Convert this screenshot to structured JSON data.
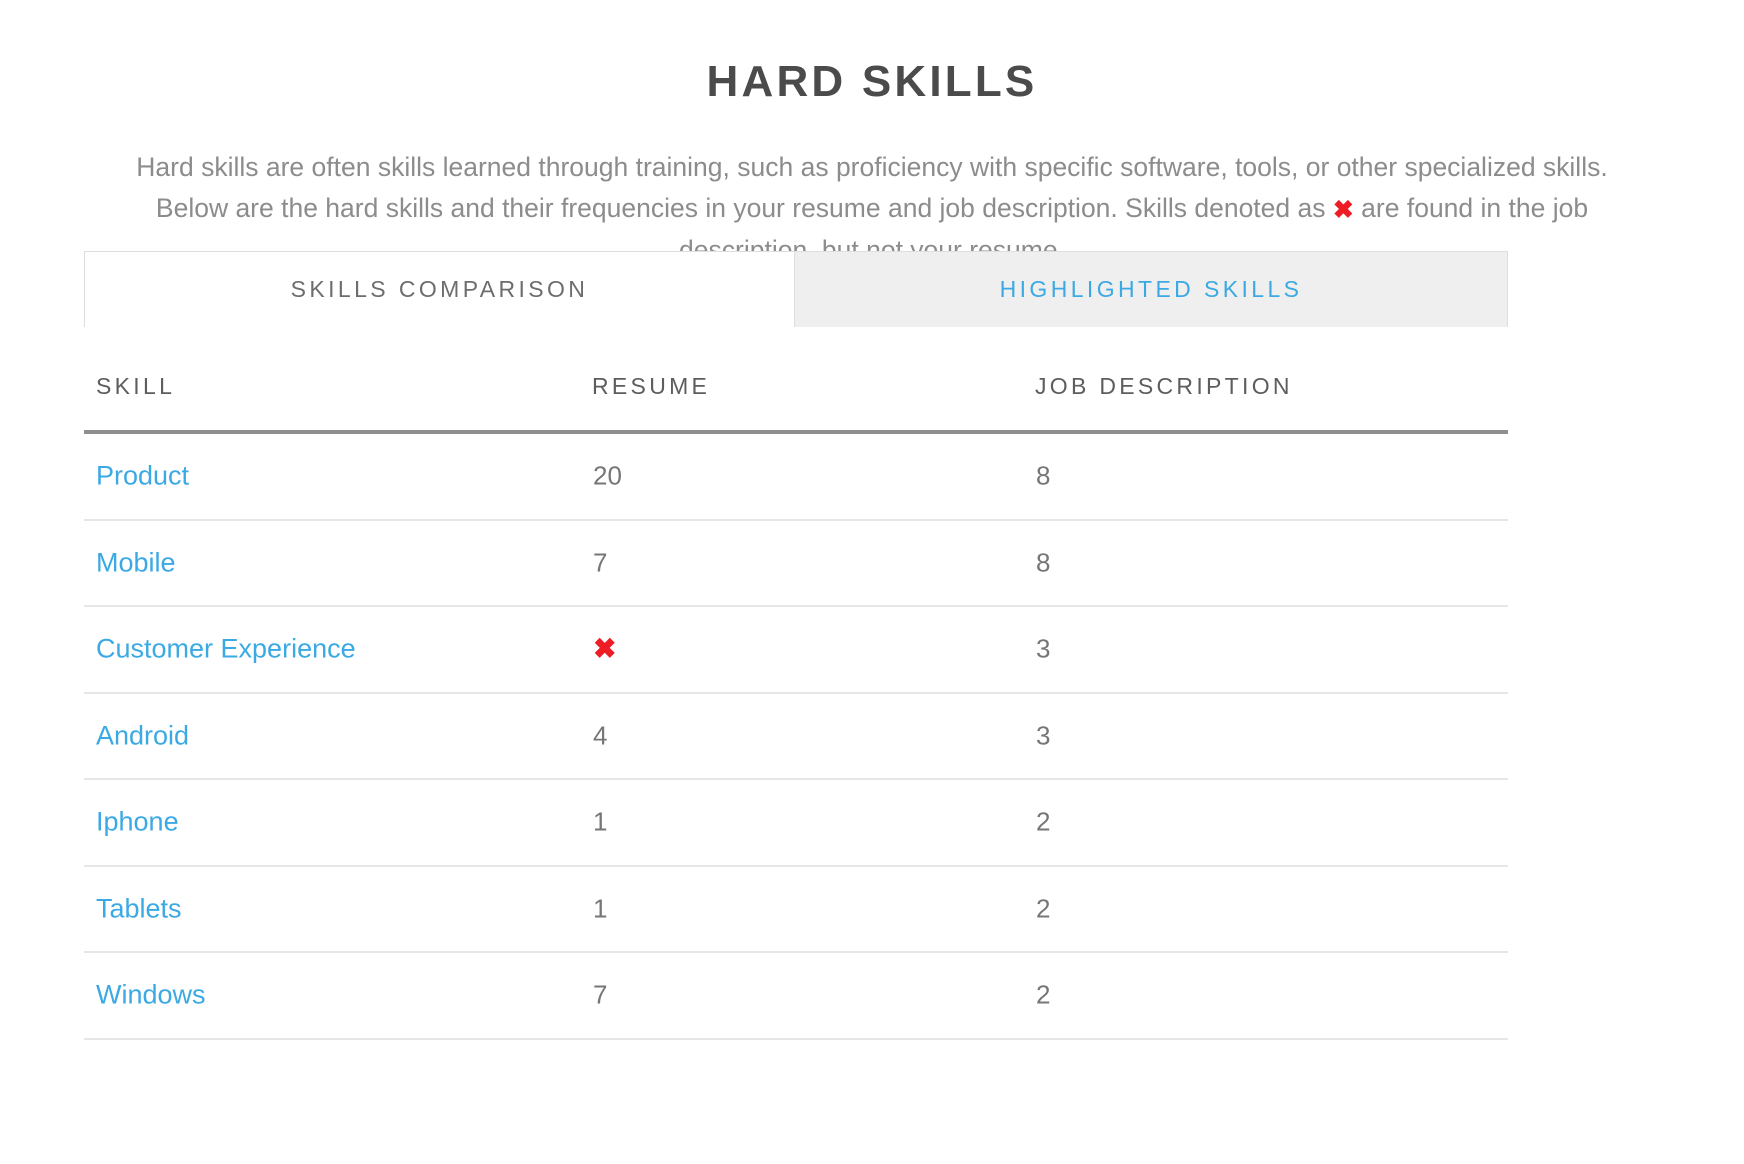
{
  "header": {
    "title": "HARD SKILLS",
    "description_part1": "Hard skills are often skills learned through training, such as proficiency with specific software, tools, or other specialized skills. Below are the hard skills and their frequencies in your resume and job description. Skills denoted as ",
    "description_xmark": "✖",
    "description_part2": " are found in the job description, but not your resume."
  },
  "tabs": [
    {
      "label": "SKILLS COMPARISON",
      "active": true
    },
    {
      "label": "HIGHLIGHTED SKILLS",
      "active": false
    }
  ],
  "table": {
    "columns": [
      "SKILL",
      "RESUME",
      "JOB DESCRIPTION"
    ],
    "rows": [
      {
        "skill": "Product",
        "resume": "20",
        "job_description": "8",
        "resume_missing": false
      },
      {
        "skill": "Mobile",
        "resume": "7",
        "job_description": "8",
        "resume_missing": false
      },
      {
        "skill": "Customer Experience",
        "resume": "✖",
        "job_description": "3",
        "resume_missing": true
      },
      {
        "skill": "Android",
        "resume": "4",
        "job_description": "3",
        "resume_missing": false
      },
      {
        "skill": "Iphone",
        "resume": "1",
        "job_description": "2",
        "resume_missing": false
      },
      {
        "skill": "Tablets",
        "resume": "1",
        "job_description": "2",
        "resume_missing": false
      },
      {
        "skill": "Windows",
        "resume": "7",
        "job_description": "2",
        "resume_missing": false
      }
    ]
  },
  "colors": {
    "link_blue": "#3ba9e3",
    "xmark_red": "#ee1c25",
    "title_gray": "#4b4b4b",
    "body_gray": "#8c8c8c",
    "rule_gray": "#8e8e8e",
    "tab_inactive_bg": "#efefef"
  }
}
